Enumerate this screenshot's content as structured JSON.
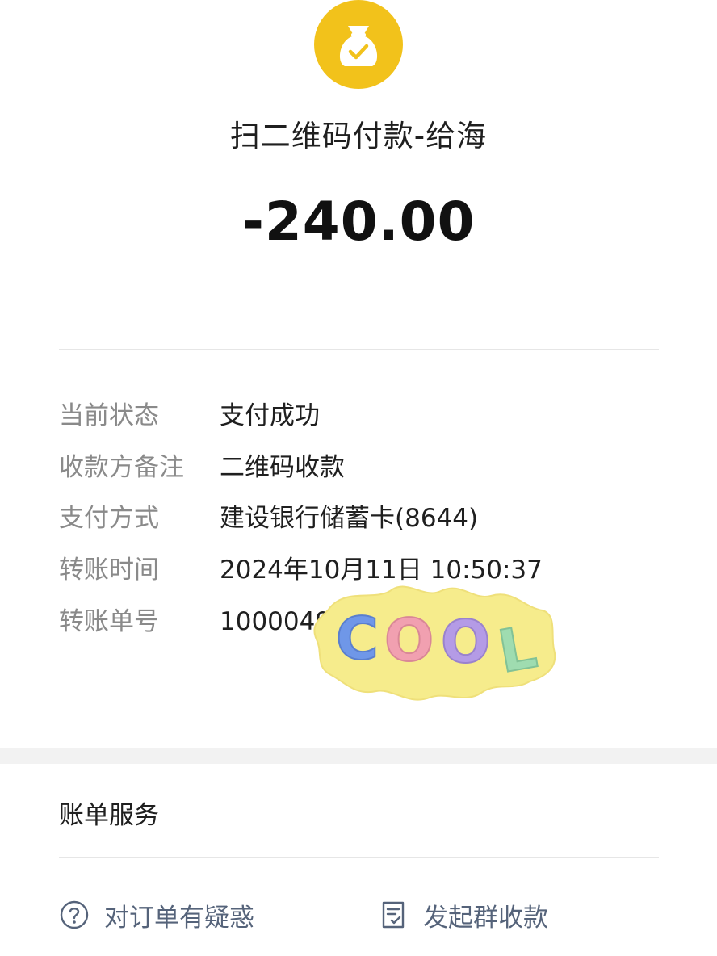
{
  "merchant": {
    "icon": "money-bag-check-icon",
    "icon_color": "#f2c21b"
  },
  "title": "扫二维码付款-给海",
  "amount": "-240.00",
  "details": [
    {
      "label": "当前状态",
      "value": "支付成功"
    },
    {
      "label": "收款方备注",
      "value": "二维码收款"
    },
    {
      "label": "支付方式",
      "value": "建设银行储蓄卡(8644)"
    },
    {
      "label": "转账时间",
      "value": "2024年10月11日 10:50:37"
    },
    {
      "label": "转账单号",
      "value": "10000496791759543"
    }
  ],
  "sticker": {
    "text": "COOL",
    "letters": [
      "C",
      "O",
      "O",
      "L"
    ]
  },
  "services": {
    "title": "账单服务",
    "actions": [
      {
        "icon": "question-circle-icon",
        "label": "对订单有疑惑"
      },
      {
        "icon": "bill-check-icon",
        "label": "发起群收款"
      }
    ]
  }
}
